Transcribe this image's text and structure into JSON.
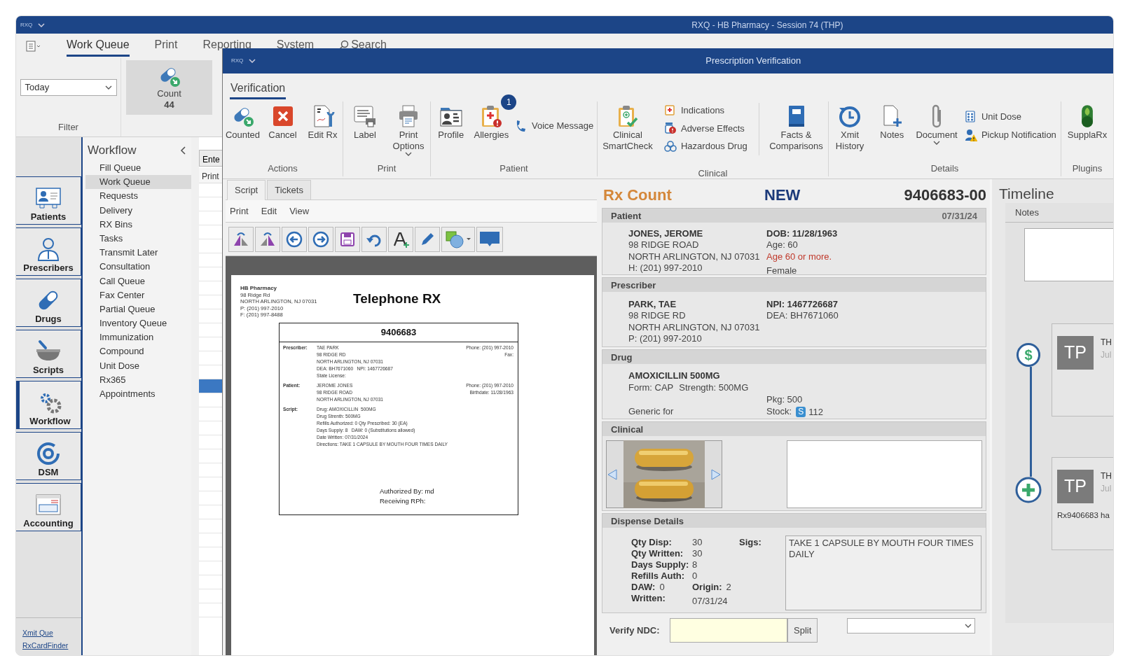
{
  "main_window": {
    "logo": "RXQ",
    "title": "RXQ - HB Pharmacy - Session 74 (THP)"
  },
  "menu_tabs": [
    {
      "label": "Work Queue",
      "selected": true,
      "kind": "tab"
    },
    {
      "label": "Print",
      "selected": false,
      "kind": "tab"
    },
    {
      "label": "Reporting",
      "selected": false,
      "kind": "tab"
    },
    {
      "label": "System",
      "selected": false,
      "kind": "tab"
    },
    {
      "label": "Search",
      "selected": false,
      "kind": "search"
    }
  ],
  "filter": {
    "date_range": "Today",
    "label": "Filter"
  },
  "count_button": {
    "label": "Count",
    "count": "44"
  },
  "nav": [
    {
      "label": "Patients",
      "selected": false
    },
    {
      "label": "Prescribers",
      "selected": false
    },
    {
      "label": "Drugs",
      "selected": false
    },
    {
      "label": "Scripts",
      "selected": false
    },
    {
      "label": "Workflow",
      "selected": true
    },
    {
      "label": "DSM",
      "selected": false
    },
    {
      "label": "Accounting",
      "selected": false
    }
  ],
  "footer_links": [
    "Xmit Que",
    "RxCardFinder"
  ],
  "workflow": {
    "title": "Workflow",
    "items": [
      {
        "label": "Fill Queue",
        "selected": false
      },
      {
        "label": "Work Queue",
        "selected": true
      },
      {
        "label": "Requests",
        "selected": false
      },
      {
        "label": "Delivery",
        "selected": false
      },
      {
        "label": "RX Bins",
        "selected": false
      },
      {
        "label": "Tasks",
        "selected": false
      },
      {
        "label": "Transmit Later",
        "selected": false
      },
      {
        "label": "Consultation",
        "selected": false
      },
      {
        "label": "Call Queue",
        "selected": false
      },
      {
        "label": "Fax Center",
        "selected": false
      },
      {
        "label": "Partial Queue",
        "selected": false
      },
      {
        "label": "Inventory Queue",
        "selected": false
      },
      {
        "label": "Immunization",
        "selected": false
      },
      {
        "label": "Compound",
        "selected": false
      },
      {
        "label": "Unit Dose",
        "selected": false
      },
      {
        "label": "Rx365",
        "selected": false
      },
      {
        "label": "Appointments",
        "selected": false
      }
    ]
  },
  "queue_grid": {
    "button": "Ente",
    "column_1": "Print",
    "rows": [
      {
        "selected": false
      },
      {
        "selected": false
      },
      {
        "selected": false
      },
      {
        "selected": false
      },
      {
        "selected": false
      },
      {
        "selected": false
      },
      {
        "selected": false
      },
      {
        "selected": false
      },
      {
        "selected": false
      },
      {
        "selected": false
      },
      {
        "selected": false
      },
      {
        "selected": false
      },
      {
        "selected": false
      },
      {
        "selected": false
      },
      {
        "selected": true
      },
      {
        "selected": false
      },
      {
        "selected": false
      },
      {
        "selected": false
      },
      {
        "selected": false
      },
      {
        "selected": false
      },
      {
        "selected": false
      },
      {
        "selected": false
      },
      {
        "selected": false
      },
      {
        "selected": false
      },
      {
        "selected": false
      },
      {
        "selected": false
      },
      {
        "selected": false
      },
      {
        "selected": false
      },
      {
        "selected": false
      },
      {
        "selected": false
      },
      {
        "selected": false
      }
    ]
  },
  "verification_window": {
    "logo": "RXQ",
    "title": "Prescription Verification",
    "ribbon_tab": "Verification",
    "groups": [
      {
        "label": "Actions",
        "buttons": [
          {
            "label": "Counted",
            "kind": "large"
          },
          {
            "label": "Cancel",
            "kind": "large"
          },
          {
            "label": "Edit Rx",
            "kind": "large"
          }
        ]
      },
      {
        "label": "Print",
        "buttons": [
          {
            "label": "Label",
            "kind": "large"
          },
          {
            "label": "Print Options",
            "kind": "large",
            "menu": true
          }
        ]
      },
      {
        "label": "Patient",
        "buttons": [
          {
            "label": "Profile",
            "kind": "large"
          },
          {
            "label": "Allergies",
            "kind": "large",
            "badge": "1"
          },
          {
            "label": "Voice Message",
            "kind": "small"
          }
        ]
      },
      {
        "label": "Clinical",
        "buttons": [
          {
            "label": "Clinical SmartCheck",
            "kind": "large"
          },
          {
            "label": "Indications",
            "kind": "small"
          },
          {
            "label": "Adverse Effects",
            "kind": "small"
          },
          {
            "label": "Hazardous Drug",
            "kind": "small"
          },
          {
            "label": "Facts & Comparisons",
            "kind": "large"
          }
        ]
      },
      {
        "label": "Details",
        "buttons": [
          {
            "label": "Xmit History",
            "kind": "large"
          },
          {
            "label": "Notes",
            "kind": "large"
          },
          {
            "label": "Document",
            "kind": "large",
            "menu": true
          },
          {
            "label": "Unit Dose",
            "kind": "small"
          },
          {
            "label": "Pickup Notification",
            "kind": "small"
          }
        ]
      },
      {
        "label": "Plugins",
        "buttons": [
          {
            "label": "SupplaRx",
            "kind": "large"
          }
        ]
      }
    ]
  },
  "script_panel": {
    "tabs": [
      {
        "label": "Script",
        "selected": true
      },
      {
        "label": "Tickets",
        "selected": false
      }
    ],
    "menu": [
      "Print",
      "Edit",
      "View"
    ],
    "document": {
      "pharmacy": [
        "HB Pharmacy",
        "98 Ridge Rd",
        "NORTH ARLINGTON, NJ 07031",
        "P: (201) 997-2010",
        "F: (201) 997-8488"
      ],
      "title": "Telephone RX",
      "rx_number": "9406683",
      "sections": [
        {
          "label": "Prescriber:",
          "lines": [
            "TAE PARK",
            "98 RIDGE RD",
            "NORTH ARLINGTON, NJ 07031",
            "DEA: BH7671060   NPI: 1467726687",
            "State License:"
          ],
          "right": [
            "Phone: (201) 997-2010",
            "Fax:"
          ]
        },
        {
          "label": "Patient:",
          "lines": [
            "JEROME JONES",
            "98 RIDGE ROAD",
            "NORTH ARLINGTON, NJ 07031"
          ],
          "right": [
            "Phone: (201) 997-2010",
            "Birthdate: 11/28/1963"
          ]
        },
        {
          "label": "Script:",
          "lines": [
            "Drug: AMOXICILLIN  500MG",
            "Drug Strenth: 500MG",
            "Refills Authorized: 0 Qty Prescribed: 30 (EA)",
            "Days Supply: 8   DAW: 0 (Substitutions allowed)",
            "Date Written: 07/31/2024",
            "Directions: TAKE 1 CAPSULE BY MOUTH FOUR TIMES DAILY"
          ]
        }
      ],
      "authorized_by": "Authorized By: md",
      "receiving_rph": "Receiving RPh:"
    }
  },
  "rx_panel": {
    "status": "Rx Count",
    "state": "NEW",
    "rx_number": "9406683-00",
    "patient": {
      "title": "Patient",
      "date": "07/31/24",
      "name": "JONES, JEROME",
      "address": [
        "98 RIDGE ROAD",
        "NORTH ARLINGTON, NJ 07031",
        "H: (201) 997-2010"
      ],
      "dob": "DOB: 11/28/1963",
      "age": "Age: 60",
      "alert": "Age 60 or more.",
      "sex": "Female"
    },
    "prescriber": {
      "title": "Prescriber",
      "name": "PARK, TAE",
      "address": [
        "98 RIDGE RD",
        "NORTH ARLINGTON, NJ 07031",
        "P: (201) 997-2010"
      ],
      "npi": "NPI: 1467726687",
      "dea": "DEA: BH7671060"
    },
    "drug": {
      "title": "Drug",
      "name": "AMOXICILLIN  500MG",
      "form": "Form: CAP",
      "strength": "Strength: 500MG",
      "generic": "Generic for",
      "pkg": "Pkg: 500",
      "stock_label": "Stock:",
      "stock_badge": "S",
      "stock": "112"
    },
    "clinical": {
      "title": "Clinical"
    },
    "dispense": {
      "title": "Dispense Details",
      "fields": [
        {
          "label": "Qty Disp:",
          "value": "30"
        },
        {
          "label": "Qty Written:",
          "value": "30"
        },
        {
          "label": "Days Supply:",
          "value": "8"
        },
        {
          "label": "Refills Auth:",
          "value": "0"
        }
      ],
      "daw_label": "DAW:",
      "daw": "0",
      "origin_label": "Origin:",
      "origin": "2",
      "written_label": "Written:",
      "written": "07/31/24",
      "sigs_label": "Sigs:",
      "sigs": "TAKE 1 CAPSULE BY MOUTH FOUR TIMES DAILY"
    },
    "verify": {
      "label": "Verify NDC:",
      "button": "Split"
    }
  },
  "timeline": {
    "title": "Timeline",
    "tab": "Notes",
    "entries": [
      {
        "kind": "payment",
        "symbol": "$",
        "initials": "TP",
        "title": "TH",
        "date": "Jul"
      },
      {
        "kind": "new",
        "initials": "TP",
        "title": "TH",
        "date": "Jul",
        "text": "Rx9406683 ha"
      }
    ]
  }
}
